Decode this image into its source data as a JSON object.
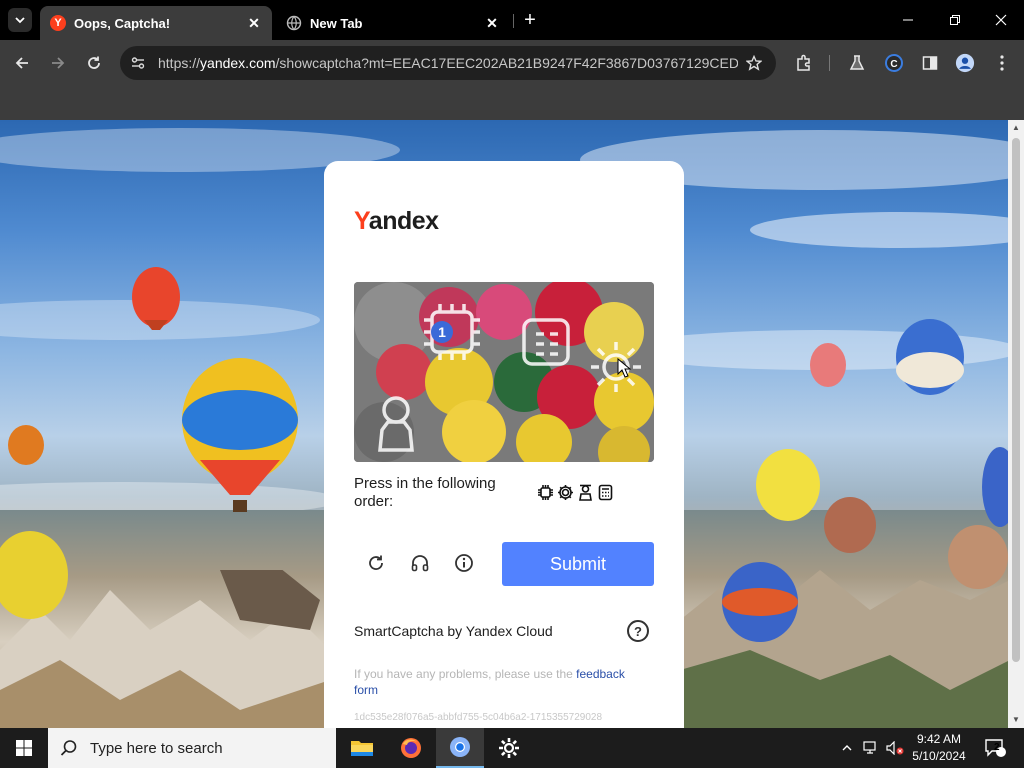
{
  "browser": {
    "tabs": [
      {
        "title": "Oops, Captcha!",
        "favicon": "yandex-icon",
        "favicon_letter": "Y",
        "active": true
      },
      {
        "title": "New Tab",
        "favicon": "globe-icon",
        "active": false
      }
    ],
    "new_tab_symbol": "+",
    "url_prefix": "https://",
    "url_host": "yandex.com",
    "url_path": "/showcaptcha?mt=EEAC17EEC202AB21B9247F42F3867D03767129CED70..."
  },
  "captcha": {
    "logo_first": "Y",
    "logo_rest": "andex",
    "instruction": "Press in the following order:",
    "order_icons": [
      "chip-icon",
      "gear-icon",
      "person-icon",
      "calculator-icon"
    ],
    "image_badge": "1",
    "submit_label": "Submit",
    "provider": "SmartCaptcha by Yandex Cloud",
    "help_symbol": "?",
    "problems_text": "If you have any problems, please use the ",
    "problems_link": "feedback form",
    "hash": "1dc535e28f076a5-abbfd755-5c04b6a2-1715355729028"
  },
  "taskbar": {
    "search_placeholder": "Type here to search",
    "time": "9:42 AM",
    "date": "5/10/2024",
    "notification_count": "2"
  },
  "colors": {
    "yandex_red": "#fc3f1d",
    "submit_blue": "#5282ff",
    "chrome_dark": "#3c3c3c"
  }
}
